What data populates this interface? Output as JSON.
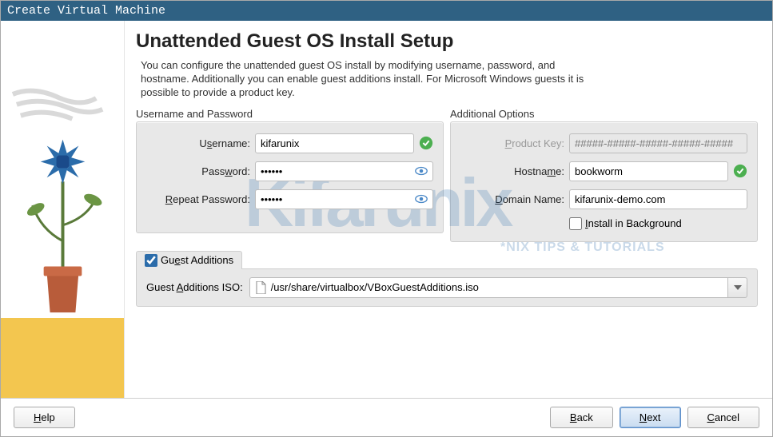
{
  "title": "Create Virtual Machine",
  "heading": "Unattended Guest OS Install Setup",
  "intro": "You can configure the unattended guest OS install by modifying username, password, and hostname. Additionally you can enable guest additions install. For Microsoft Windows guests it is possible to provide a product key.",
  "sections": {
    "userpass": {
      "legend": "Username and Password",
      "username_label": "Username:",
      "username_value": "kifarunix",
      "password_label": "Password:",
      "password_value": "••••••",
      "repeat_label": "Repeat Password:",
      "repeat_value": "••••••"
    },
    "additional": {
      "legend": "Additional Options",
      "product_key_label": "Product Key:",
      "product_key_placeholder": "#####-#####-#####-#####-#####",
      "hostname_label": "Hostname:",
      "hostname_value": "bookworm",
      "domain_label": "Domain Name:",
      "domain_value": "kifarunix-demo.com",
      "install_bg_label": "Install in Background",
      "install_bg_checked": false
    },
    "guest_additions": {
      "legend": "Guest Additions",
      "checked": true,
      "iso_label": "Guest Additions ISO:",
      "iso_value": "/usr/share/virtualbox/VBoxGuestAdditions.iso"
    }
  },
  "watermark": {
    "main": "Kifarunix",
    "sub": "*NIX TIPS & TUTORIALS"
  },
  "footer": {
    "help": "Help",
    "back": "Back",
    "next": "Next",
    "cancel": "Cancel"
  }
}
